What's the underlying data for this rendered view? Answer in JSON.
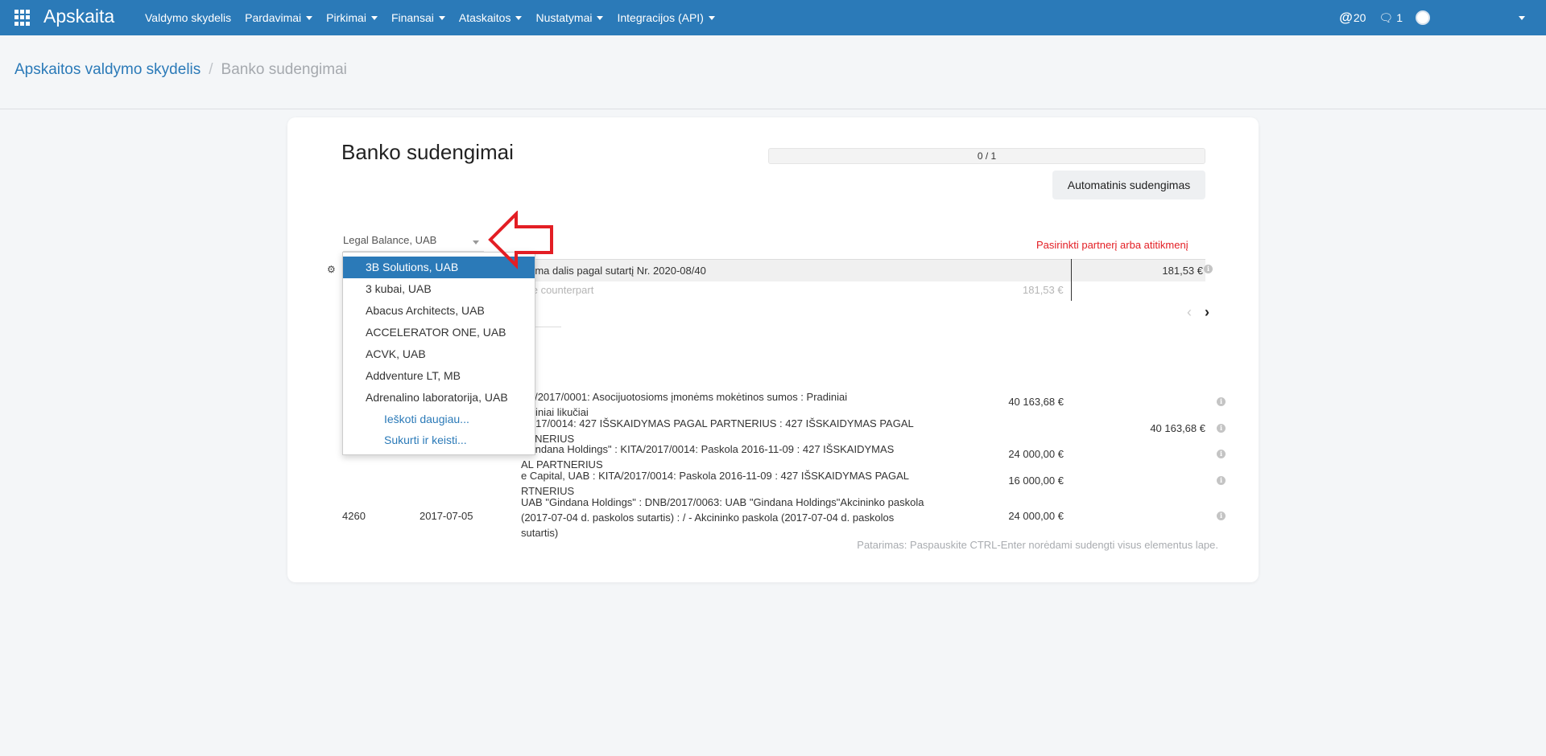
{
  "navbar": {
    "brand": "Apskaita",
    "menu": [
      {
        "label": "Valdymo skydelis",
        "dropdown": false
      },
      {
        "label": "Pardavimai",
        "dropdown": true
      },
      {
        "label": "Pirkimai",
        "dropdown": true
      },
      {
        "label": "Finansai",
        "dropdown": true
      },
      {
        "label": "Ataskaitos",
        "dropdown": true
      },
      {
        "label": "Nustatymai",
        "dropdown": true
      },
      {
        "label": "Integracijos (API)",
        "dropdown": true
      }
    ],
    "mentions_count": "20",
    "messages_count": "1",
    "accent_color": "#2b7ab8"
  },
  "breadcrumb": {
    "parent": "Apskaitos valdymo skydelis",
    "separator": "/",
    "current": "Banko sudengimai"
  },
  "page": {
    "title": "Banko sudengimai",
    "progress_text": "0 / 1",
    "progress_fraction": 0,
    "auto_button": "Automatinis sudengimas",
    "partner_select": "Legal Balance, UAB",
    "warning": "Pasirinkti partnerį arba atitikmenį",
    "statement_label": "Grąžinama dalis pagal sutartį Nr. 2020-08/40",
    "statement_label_visible": "inama dalis pagal sutartį Nr. 2020-08/40",
    "statement_amount": "181,53 €",
    "counterpart_label": "ose counterpart",
    "counterpart_amount": "181,53 €",
    "tip": "Patarimas: Paspauskite CTRL-Enter norėdami sudengti visus elementus lape.",
    "warning_color": "#e31e24"
  },
  "dropdown": {
    "items": [
      {
        "label": "3B Solutions, UAB",
        "active": true
      },
      {
        "label": "3 kubai, UAB",
        "active": false
      },
      {
        "label": "Abacus Architects, UAB",
        "active": false
      },
      {
        "label": "ACCELERATOR ONE, UAB",
        "active": false
      },
      {
        "label": "ACVK, UAB",
        "active": false
      },
      {
        "label": "Addventure LT, MB",
        "active": false
      },
      {
        "label": "Adrenalino laboratorija, UAB",
        "active": false
      }
    ],
    "search_more": "Ieškoti daugiau...",
    "create_edit": "Sukurti ir keisti..."
  },
  "rows": [
    {
      "id": "",
      "date": "",
      "desc": "RT/2017/0001: Asocijuotosioms įmonėms mokėtinos sumos : Pradiniai\nlteriniai likučiai",
      "debit": "40 163,68 €",
      "credit": ""
    },
    {
      "id": "",
      "date": "",
      "desc": "/2017/0014: 427 IŠSKAIDYMAS PAGAL PARTNERIUS : 427 IŠSKAIDYMAS PAGAL\nRTNERIUS",
      "debit": "",
      "credit": "40 163,68 €"
    },
    {
      "id": "",
      "date": "",
      "desc": "\"Gindana Holdings\" : KITA/2017/0014: Paskola 2016-11-09 : 427 IŠSKAIDYMAS\nAL PARTNERIUS",
      "debit": "24 000,00 €",
      "credit": ""
    },
    {
      "id": "",
      "date": "",
      "desc": "e Capital, UAB : KITA/2017/0014: Paskola 2016-11-09 : 427 IŠSKAIDYMAS PAGAL\nRTNERIUS",
      "debit": "16 000,00 €",
      "credit": ""
    },
    {
      "id": "4260",
      "date": "2017-07-05",
      "desc": "UAB \"Gindana Holdings\" : DNB/2017/0063: UAB \"Gindana Holdings\"Akcininko paskola\n(2017-07-04 d. paskolos sutartis) : / - Akcininko paskola (2017-07-04 d. paskolos\nsutartis)",
      "debit": "24 000,00 €",
      "credit": ""
    }
  ]
}
